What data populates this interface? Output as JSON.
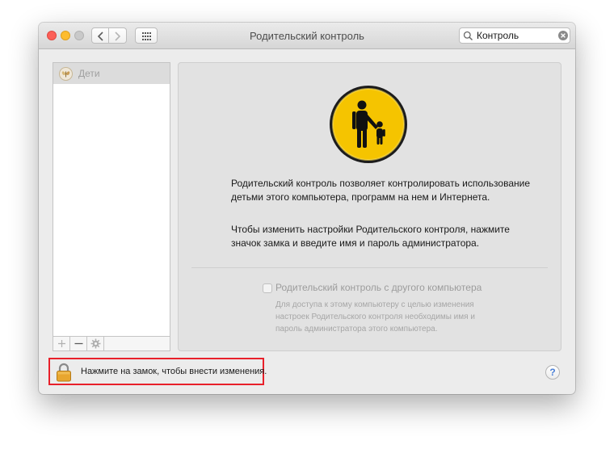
{
  "window": {
    "title": "Родительский контроль"
  },
  "search": {
    "value": "Контроль"
  },
  "sidebar": {
    "items": [
      {
        "label": "Дети",
        "icon": "butterfly-icon"
      }
    ],
    "footer": {
      "add": "+",
      "remove": "−"
    }
  },
  "main": {
    "description_1": "Родительский контроль позволяет контролировать использование детьми этого компьютера, программ на нем и Интернета.",
    "description_2": "Чтобы изменить настройки Родительского контроля, нажмите значок замка и введите имя и пароль администратора.",
    "remote_checkbox": {
      "label": "Родительский контроль с другого компьютера",
      "checked": false,
      "enabled": false
    },
    "remote_note": "Для доступа к этому компьютеру с целью изменения настроек Родительского контроля необходимы имя и пароль администратора этого компьютера."
  },
  "footer": {
    "lock_text": "Нажмите на замок, чтобы внести изменения.",
    "help": "?"
  },
  "colors": {
    "highlight": "#e8202a",
    "parental_icon": "#f5c400",
    "traffic_close": "#fc5f57",
    "traffic_minimize": "#fdbc2e",
    "traffic_zoom": "#c9c9c9"
  }
}
